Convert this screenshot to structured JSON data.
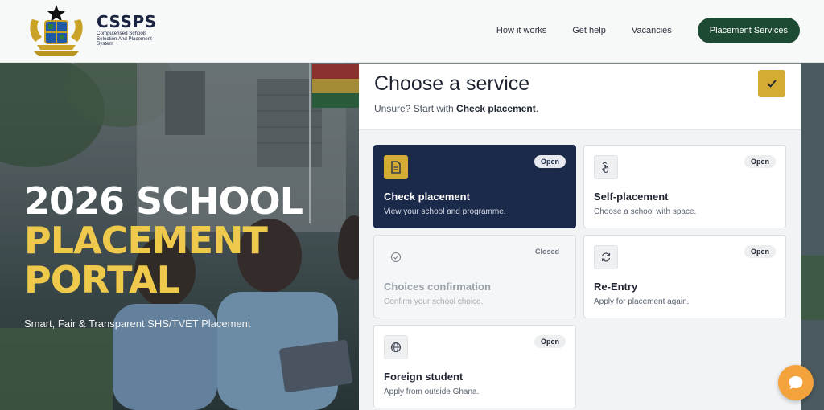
{
  "header": {
    "logo_title": "CSSPS",
    "logo_subtitle": "Computerised Schools Selection And Placement System",
    "nav": [
      "How it works",
      "Get help",
      "Vacancies"
    ],
    "cta": "Placement Services"
  },
  "hero": {
    "title_line1": "2026 SCHOOL",
    "title_line2": "PLACEMENT",
    "title_line3": "PORTAL",
    "subtitle": "Smart, Fair & Transparent SHS/TVET Placement"
  },
  "panel": {
    "title": "Choose a service",
    "hint_prefix": "Unsure? Start with ",
    "hint_link": "Check placement",
    "hint_suffix": ".",
    "cards": [
      {
        "title": "Check placement",
        "desc": "View your school and programme.",
        "status": "Open",
        "icon": "document-icon"
      },
      {
        "title": "Self-placement",
        "desc": "Choose a school with space.",
        "status": "Open",
        "icon": "tap-hand-icon"
      },
      {
        "title": "Choices confirmation",
        "desc": "Confirm your school choice.",
        "status": "Closed",
        "icon": "check-circle-icon"
      },
      {
        "title": "Re-Entry",
        "desc": "Apply for placement again.",
        "status": "Open",
        "icon": "refresh-icon"
      },
      {
        "title": "Foreign student",
        "desc": "Apply from outside Ghana.",
        "status": "Open",
        "icon": "globe-icon"
      }
    ]
  },
  "colors": {
    "brand_green": "#1d4a33",
    "navy": "#1b2a4a",
    "gold": "#d4ac34",
    "hero_yellow": "#efc94c",
    "chat_orange": "#f3a23c"
  }
}
